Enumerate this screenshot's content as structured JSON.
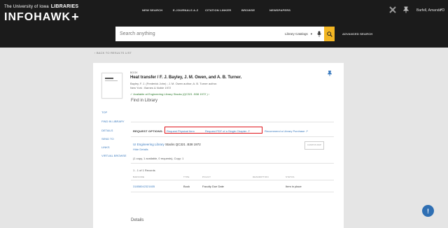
{
  "header": {
    "logo_university": "The University of Iowa",
    "logo_libraries": "LIBRARIES",
    "logo_brand": "INFOHAWK",
    "logo_plus": "+",
    "nav": [
      "NEW SEARCH",
      "E-JOURNALS A-Z",
      "CITATION LINKER",
      "BROWSE",
      "NEWSPAPERS"
    ],
    "icon_flag": "puzzle-icon",
    "icon_pin": "pin-icon",
    "user_name": "Barfell, Amanda D",
    "user_caret": "▾"
  },
  "search": {
    "placeholder": "Search anything",
    "scope": "Library Catalogs",
    "scope_caret": "▾",
    "mic_icon": "🎙",
    "go_icon": "⌕",
    "advanced": "ADVANCED SEARCH"
  },
  "back": "‹ BACK TO RESULTS LIST",
  "record": {
    "type": "BOOK",
    "title": "Heat transfer / F. J. Bayley, J. M. Owen, and A. B. Turner.",
    "authors": "Bayley, F. J. (Frederick John) ; J. M. Owen author; A. B. Turner author.",
    "publisher": "New York : Barnes & Noble 1972",
    "availability": "✓ Available at Engineering Library  Stacks (QC321 .B38 1972 ) ›"
  },
  "sidebar": [
    "TOP",
    "FIND IN LIBRARY",
    "DETAILS",
    "SEND TO",
    "LINKS",
    "VIRTUAL BROWSE"
  ],
  "find": {
    "heading": "Find in Library",
    "request_label": "REQUEST OPTIONS:",
    "request_options": [
      "Request Physical Item",
      "Request PDF of a Single Chapter ↗",
      "Recommend a Library Purchase ↗"
    ],
    "location_library": "UI Engineering Library",
    "location_rest": "  Stacks  QC321 .B38 1972",
    "hide_details": "Hide Details",
    "campus_label": "CAMPUS MAP",
    "copies": "(1 copy, 1 available, 0 requests), Copy: 1",
    "records": "1 - 1 of 1 Records",
    "columns": [
      "BARCODE",
      "TYPE",
      "POLICY",
      "DESCRIPTION",
      "STATUS"
    ],
    "row": [
      "31858042321605",
      "Book",
      "Faculty Due Date",
      "",
      "Item in place"
    ]
  },
  "details_heading": "Details",
  "help_icon": "!"
}
